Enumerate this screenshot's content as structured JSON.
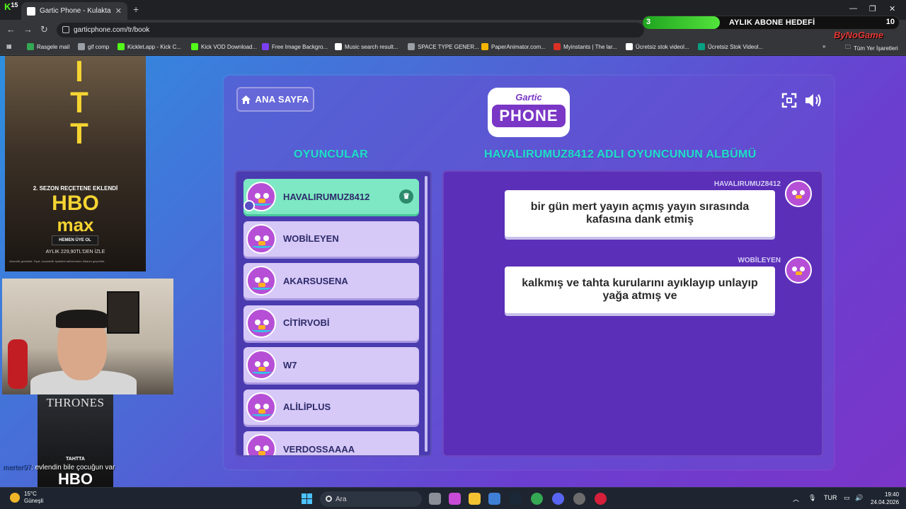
{
  "browser": {
    "kick_badge": "15",
    "tab_title": "Gartic Phone - Kulaktan Ku...",
    "tab_close": "✕",
    "new_tab": "+",
    "url": "garticphone.com/tr/book",
    "window_controls": [
      "—",
      "❐",
      "✕"
    ],
    "bookmarks": [
      {
        "label": "Rasgele mail",
        "color": "#34a853"
      },
      {
        "label": "gif comp",
        "color": "#9aa0a6"
      },
      {
        "label": "Kicklet.app - Kick C...",
        "color": "#53fc18"
      },
      {
        "label": "Kick VOD Download...",
        "color": "#53fc18"
      },
      {
        "label": "Free Image Backgro...",
        "color": "#7b3ff2"
      },
      {
        "label": "Music search result...",
        "color": "#ffffff"
      },
      {
        "label": "SPACE TYPE GENER...",
        "color": "#9aa0a6"
      },
      {
        "label": "PaperAnimator.com...",
        "color": "#f4b400"
      },
      {
        "label": "Myinstants | The lar...",
        "color": "#d93025"
      },
      {
        "label": "Ücretsiz stok videol...",
        "color": "#ffffff"
      },
      {
        "label": "Ücretsiz Stok Videol...",
        "color": "#05a081"
      }
    ],
    "all_bookmarks": "Tüm Yer İşaretleri"
  },
  "overlay": {
    "sub_goal_current": "3",
    "sub_goal_label": "AYLIK ABONE HEDEFİ",
    "sub_goal_target": "10",
    "sub_goal_progress": 0.3,
    "brand": "ByNoGame"
  },
  "game": {
    "home_label": "ANA SAYFA",
    "logo_top": "Gartic",
    "logo_bottom": "PHONE",
    "players_header": "OYUNCULAR",
    "album_header": "HAVALIRUMUZ8412 ADLI OYUNCUNUN ALBÜMÜ",
    "players": [
      {
        "name": "HAVALIRUMUZ8412",
        "active": true
      },
      {
        "name": "WOBİLEYEN",
        "active": false
      },
      {
        "name": "AKARSUSENA",
        "active": false
      },
      {
        "name": "CİTİRVOBİ",
        "active": false
      },
      {
        "name": "W7",
        "active": false
      },
      {
        "name": "ALİLİPLUS",
        "active": false
      },
      {
        "name": "VERDOSSAAAA",
        "active": false
      }
    ],
    "messages": [
      {
        "author": "HAVALIRUMUZ8412",
        "text": "bir gün mert yayın açmış yayın sırasında kafasına dank etmiş"
      },
      {
        "author": "WOBİLEYEN",
        "text": "kalkmış ve tahta kurularını ayıklayıp unlayıp yağa atmış ve"
      }
    ],
    "crown_icon": "♛"
  },
  "ads": {
    "poster_letters": [
      "I",
      "T",
      "T"
    ],
    "season": "2. SEZON REÇETENE EKLENDİ",
    "hbo": "HBO",
    "max": "max",
    "cta": "HEMEN ÜYE OL",
    "price": "AYLIK 229,90TL'DEN İZLE",
    "fine": "Abonelik gereklidir. Fiyat, sunulabilir fiyatlarla tarihlerinden itibaren geçerlidir.",
    "ad2_title": "THRONES",
    "ad2_line": "TAHTTA",
    "ad2_hbo": "HBO"
  },
  "chat": {
    "user": "merter97",
    "message": ": evlendin bile çocuğun var"
  },
  "taskbar": {
    "temp": "15°C",
    "condition": "Güneşli",
    "search": "Ara",
    "lang": "TUR",
    "time": "19:40",
    "date": "24.04.2026"
  }
}
